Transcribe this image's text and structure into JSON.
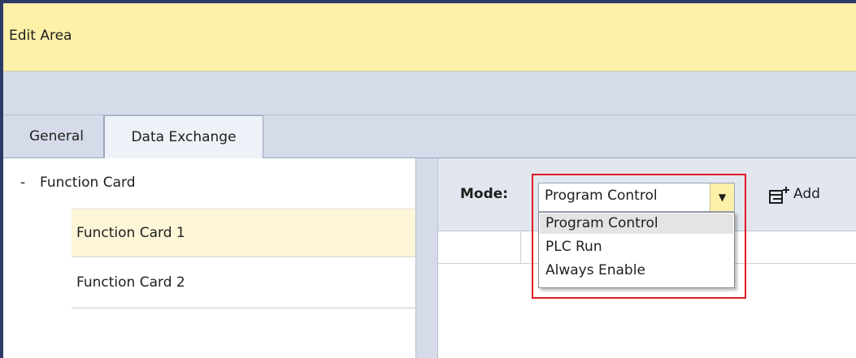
{
  "title_bar": {
    "label": "Edit Area"
  },
  "tabs": [
    {
      "label": "General",
      "active": false
    },
    {
      "label": "Data Exchange",
      "active": true
    }
  ],
  "tree": {
    "root_label": "Function Card",
    "root_toggle": "-",
    "items": [
      {
        "label": "Function Card 1",
        "selected": true
      },
      {
        "label": "Function Card 2",
        "selected": false
      }
    ]
  },
  "mode": {
    "label": "Mode:",
    "selected_value": "Program Control",
    "options": [
      "Program Control",
      "PLC Run",
      "Always Enable"
    ],
    "highlighted_option": "Program Control"
  },
  "toolbar": {
    "add_label": "Add",
    "add_icon": "add-list-icon"
  },
  "colors": {
    "title_bg": "#fdf0a8",
    "frame": "#d5dbe8",
    "selected_row": "#fdf6d8",
    "highlight_box": "#e01b24",
    "dark_border": "#2b3a67"
  }
}
